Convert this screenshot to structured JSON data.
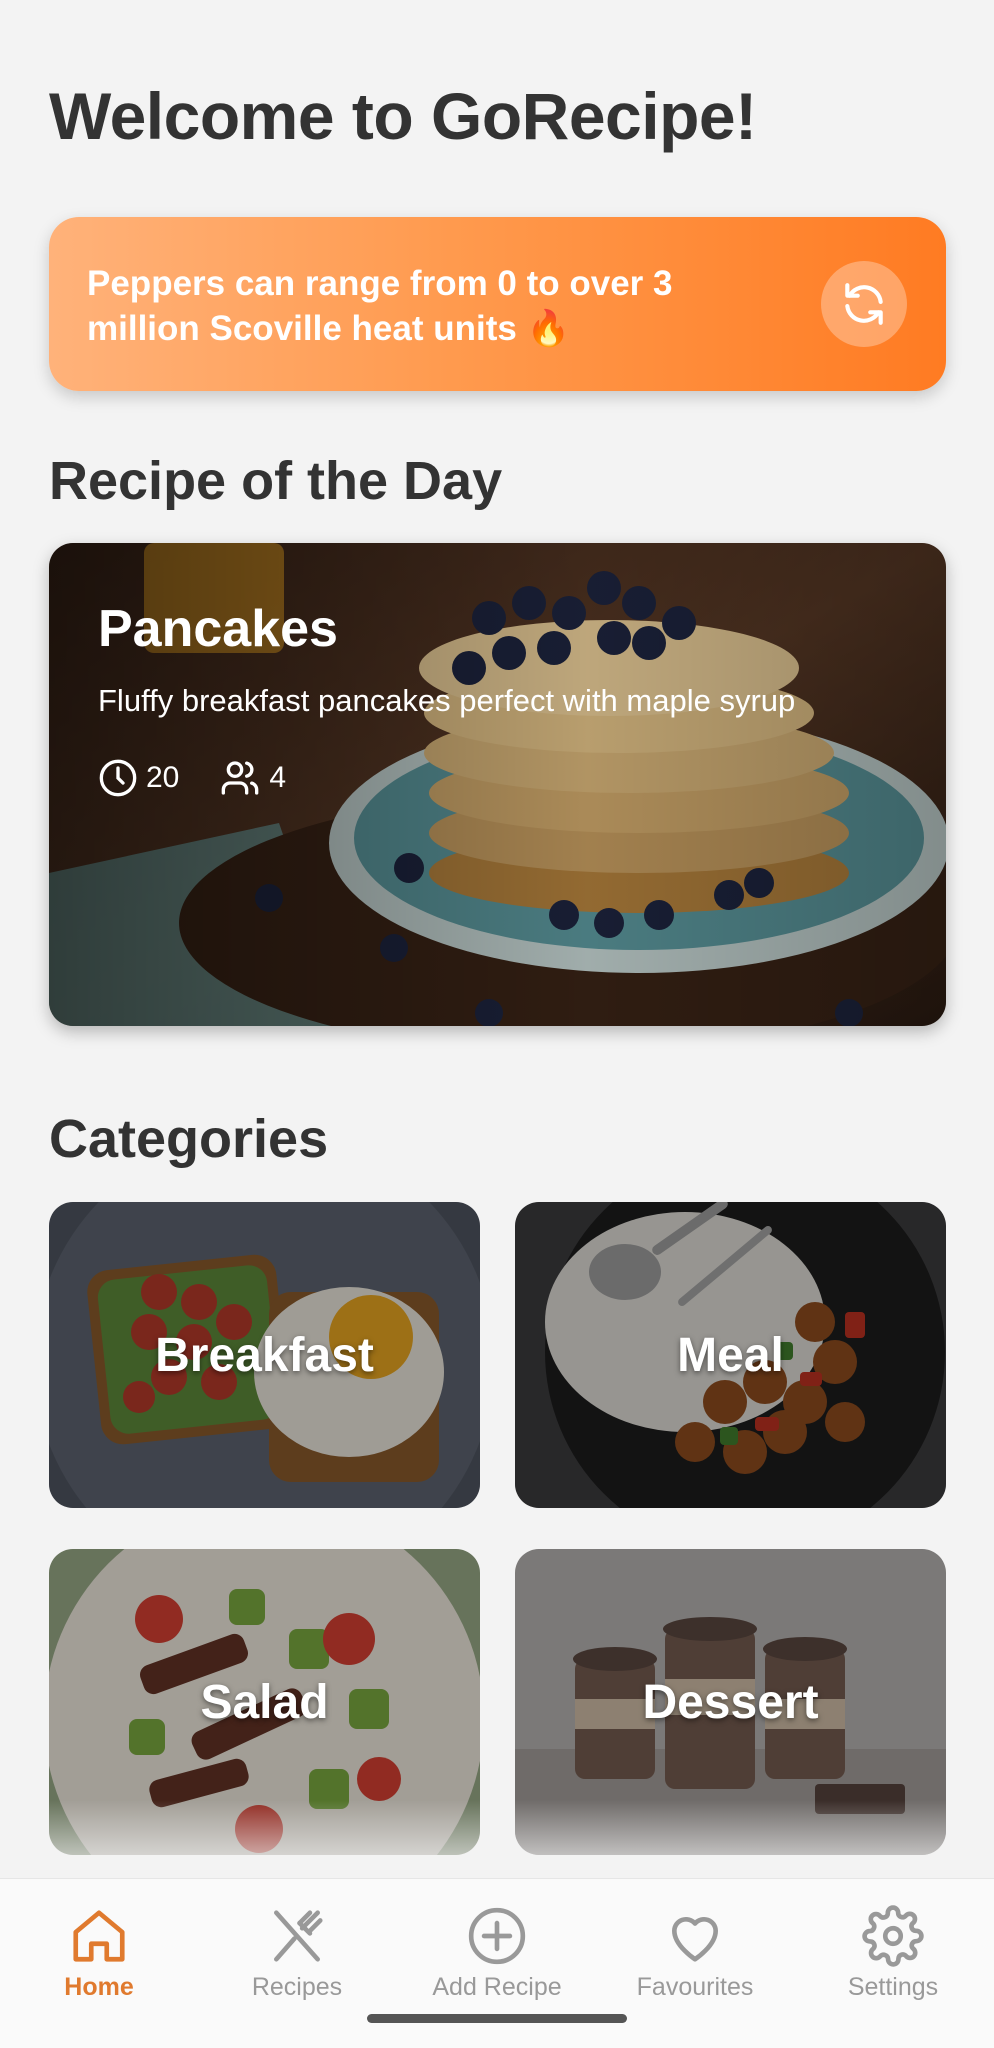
{
  "app": {
    "title": "Welcome to GoRecipe!"
  },
  "fact": {
    "text": "Peppers can range from 0 to over 3 million Scoville heat units 🔥",
    "refresh_icon": "refresh-icon"
  },
  "recipe_of_day": {
    "section_title": "Recipe of the Day",
    "name": "Pancakes",
    "description": "Fluffy breakfast pancakes perfect with maple syrup",
    "time": "20",
    "servings": "4"
  },
  "categories": {
    "section_title": "Categories",
    "items": [
      {
        "label": "Breakfast"
      },
      {
        "label": "Meal"
      },
      {
        "label": "Salad"
      },
      {
        "label": "Dessert"
      }
    ]
  },
  "nav": {
    "items": [
      {
        "label": "Home",
        "icon": "home-icon",
        "active": true
      },
      {
        "label": "Recipes",
        "icon": "utensils-icon",
        "active": false
      },
      {
        "label": "Add Recipe",
        "icon": "plus-circle-icon",
        "active": false
      },
      {
        "label": "Favourites",
        "icon": "heart-icon",
        "active": false
      },
      {
        "label": "Settings",
        "icon": "gear-icon",
        "active": false
      }
    ]
  },
  "colors": {
    "accent": "#e07a2e",
    "fact_gradient_start": "#ffb27a",
    "fact_gradient_end": "#ff7b22",
    "nav_inactive": "#999999"
  }
}
